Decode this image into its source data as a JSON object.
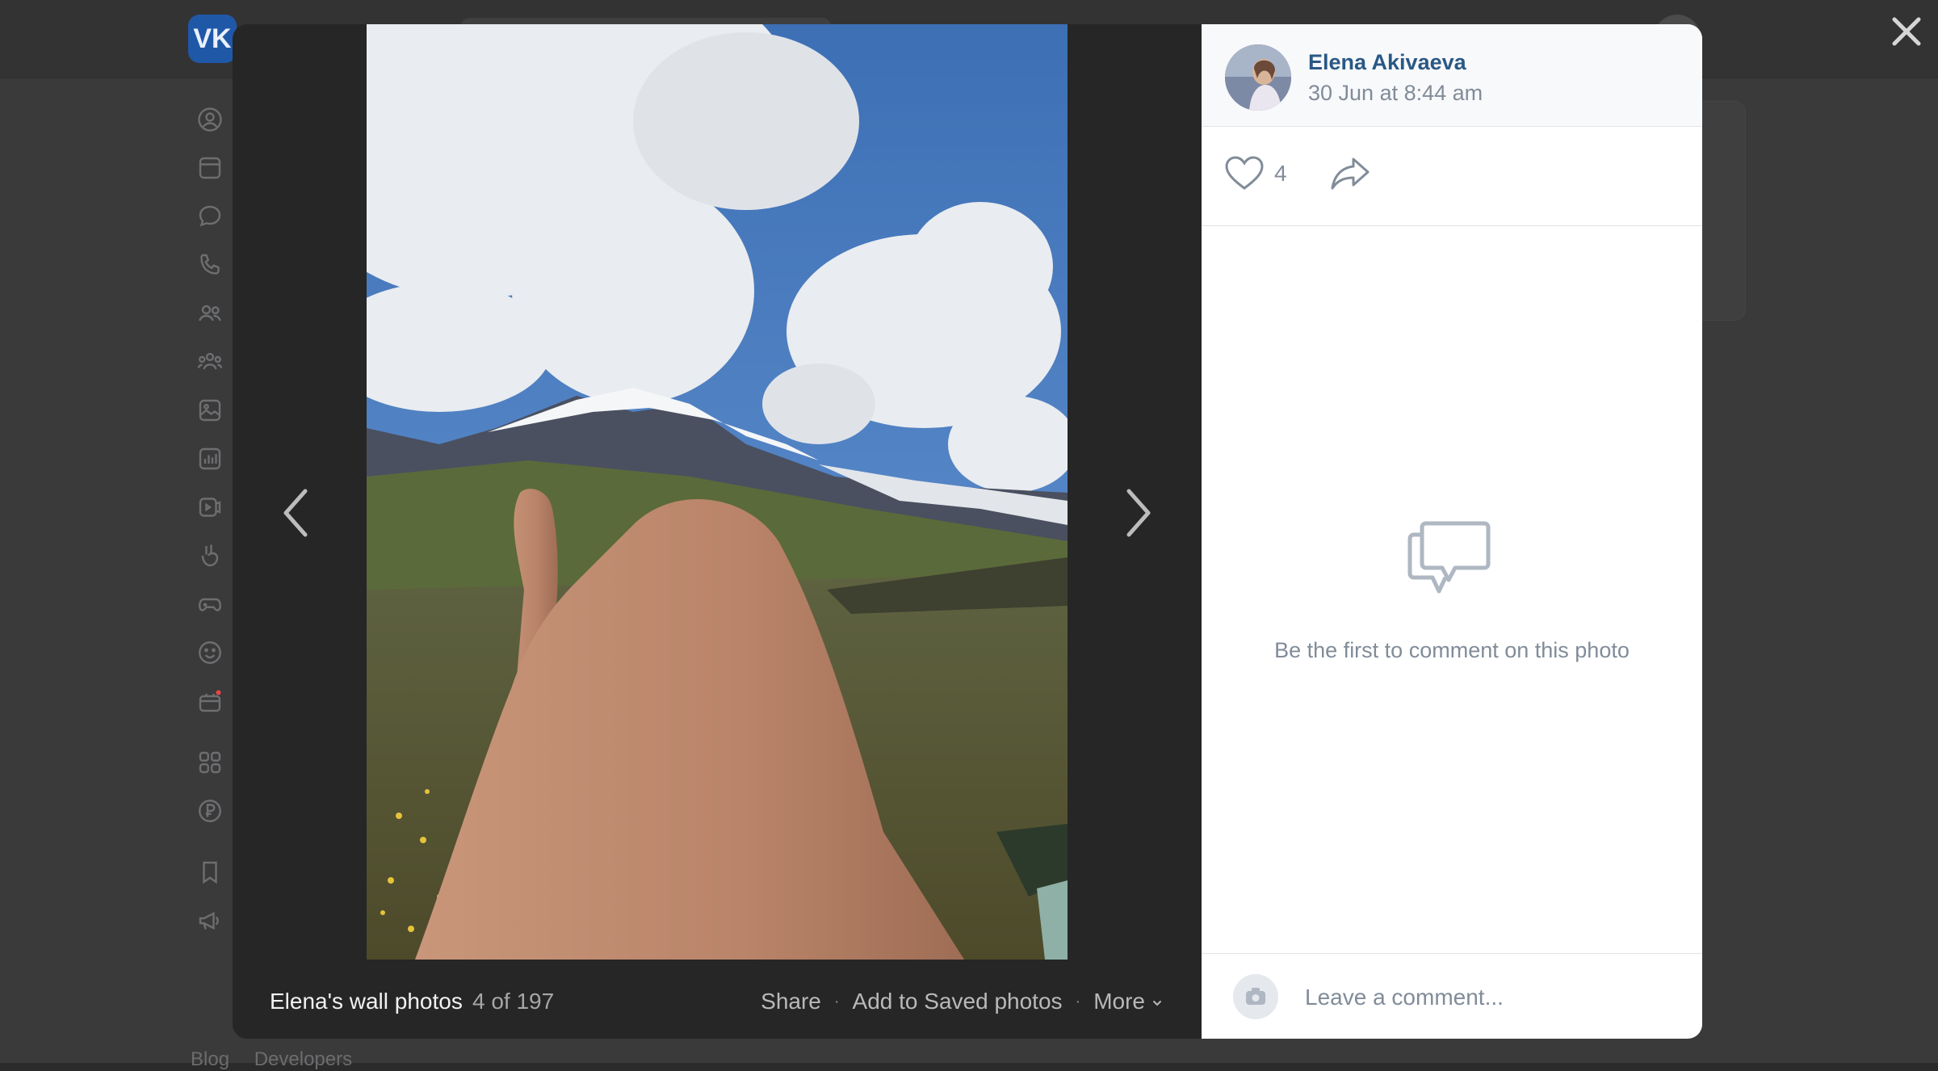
{
  "background": {
    "logo_text": "VK",
    "footer_links": [
      "Blog",
      "Developers"
    ],
    "nav_icons": [
      "profile-icon",
      "news-icon",
      "messages-icon",
      "calls-icon",
      "friends-icon",
      "communities-icon",
      "photos-icon",
      "music-icon",
      "video-icon",
      "clips-icon",
      "games-icon",
      "stickers-icon",
      "gifts-icon",
      "services-icon",
      "payments-icon",
      "bookmarks-icon",
      "ads-icon"
    ]
  },
  "viewer": {
    "album_title": "Elena's wall photos",
    "counter": "4 of 197",
    "actions": {
      "share": "Share",
      "save": "Add to Saved photos",
      "more": "More"
    }
  },
  "post": {
    "author_name": "Elena Akivaeva",
    "date": "30 Jun at 8:44 am",
    "likes": "4",
    "empty_comments": "Be the first to comment on this photo",
    "comment_placeholder": "Leave a comment..."
  },
  "colors": {
    "link": "#2a5885",
    "muted": "#818c99",
    "overlay": "#262626",
    "brand": "#2058a8"
  }
}
